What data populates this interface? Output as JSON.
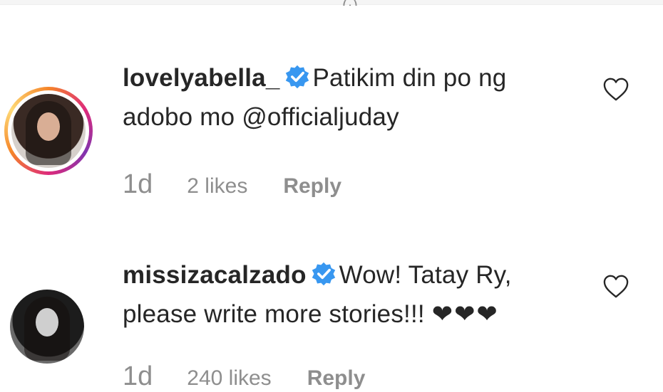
{
  "top_fragment": "(·)",
  "comments": [
    {
      "username": "lovelyabella_",
      "verified": true,
      "text": "Patikim din po ng adobo mo @officialjuday",
      "time": "1d",
      "likes": "2 likes",
      "reply_label": "Reply",
      "avatar_icon": "story-ring-avatar"
    },
    {
      "username": "missizacalzado",
      "verified": true,
      "text_line1": "Wow! Tatay Ry,",
      "text_line2": "please write more stories!!!",
      "hearts": "❤❤❤",
      "time": "1d",
      "likes": "240 likes",
      "reply_label": "Reply",
      "avatar_icon": "avatar"
    }
  ],
  "colors": {
    "verified_badge": "#3897f0",
    "meta_text": "#8e8e8e",
    "story_ring_start": "#f58529",
    "story_ring_mid": "#dd2a7b"
  }
}
